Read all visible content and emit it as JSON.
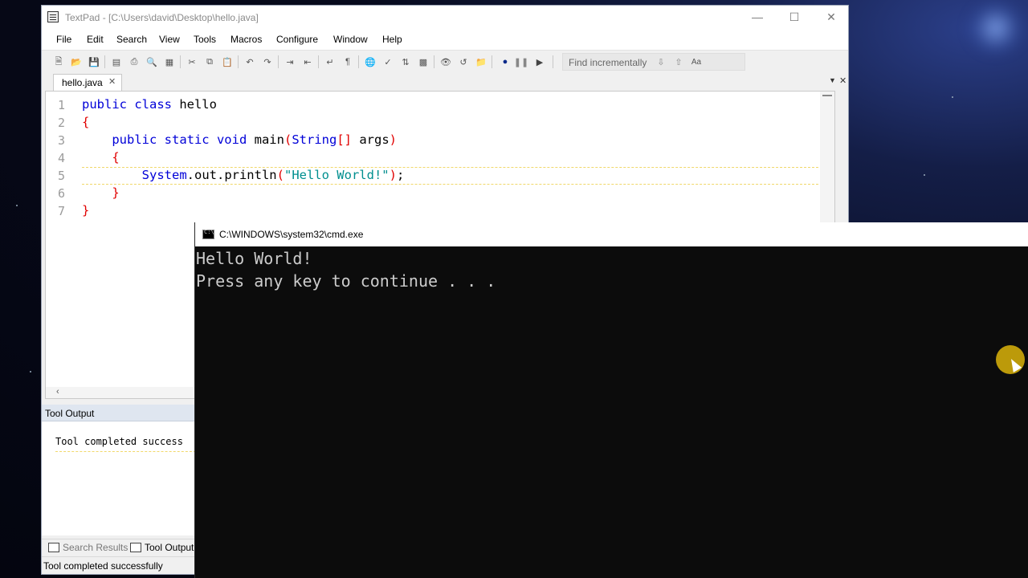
{
  "textpad": {
    "title": "TextPad - [C:\\Users\\david\\Desktop\\hello.java]",
    "menu": [
      "File",
      "Edit",
      "Search",
      "View",
      "Tools",
      "Macros",
      "Configure",
      "Window",
      "Help"
    ],
    "find_placeholder": "Find incrementally",
    "tab_label": "hello.java",
    "code_lines": [
      {
        "n": "1",
        "text": "public class hello"
      },
      {
        "n": "2",
        "text": "{"
      },
      {
        "n": "3",
        "text": "    public static void main(String[] args)"
      },
      {
        "n": "4",
        "text": "    {"
      },
      {
        "n": "5",
        "text": "        System.out.println(\"Hello World!\");"
      },
      {
        "n": "6",
        "text": "    }"
      },
      {
        "n": "7",
        "text": "}"
      }
    ],
    "tool_output_header": "Tool Output",
    "tool_output_message": "Tool completed success",
    "bottom_tabs": [
      "Search Results",
      "Tool Output"
    ],
    "status_text": "Tool completed successfully"
  },
  "cmd": {
    "title": "C:\\WINDOWS\\system32\\cmd.exe",
    "lines": [
      "Hello World!",
      "Press any key to continue . . ."
    ]
  },
  "colors": {
    "keyword": "#0000d8",
    "brace": "#e10000",
    "string": "#008f8f",
    "cursor_highlight": "#dcb40a"
  }
}
